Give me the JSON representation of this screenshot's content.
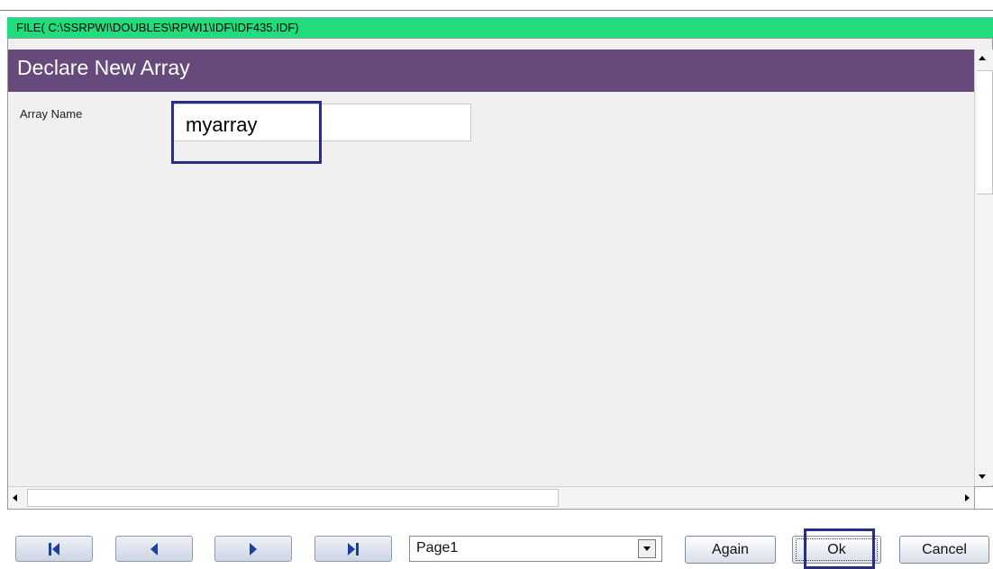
{
  "file_bar": {
    "path": "FILE( C:\\SSRPWI\\DOUBLES\\RPWI1\\IDF\\IDF435.IDF)"
  },
  "dialog": {
    "title": "Declare New Array",
    "array_name_label": "Array Name",
    "array_name_value": "myarray"
  },
  "navigation": {
    "first_icon": "first-page-icon",
    "prev_icon": "previous-page-icon",
    "next_icon": "next-page-icon",
    "last_icon": "last-page-icon",
    "page_selected": "Page1"
  },
  "buttons": {
    "again": "Again",
    "ok": "Ok",
    "cancel": "Cancel"
  },
  "colors": {
    "file_bar": "#21dc7c",
    "header": "#664a7c",
    "highlight": "#2b2d7e",
    "nav_icon": "#1b3fa0"
  }
}
